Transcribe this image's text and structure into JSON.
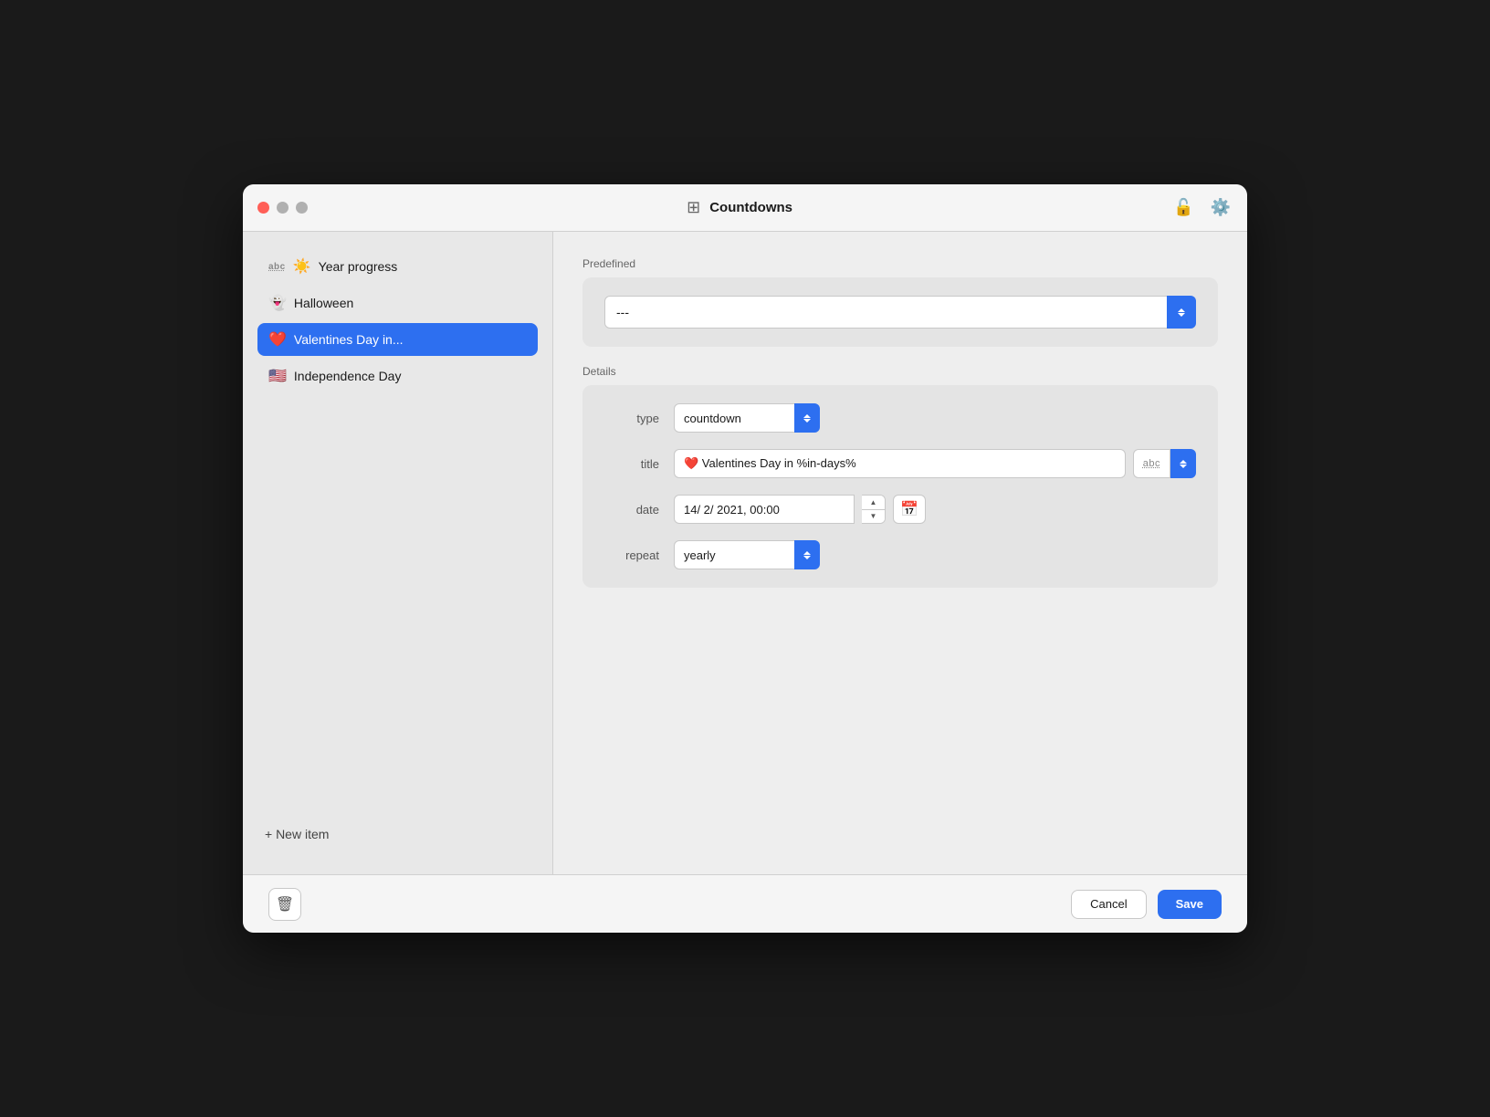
{
  "window": {
    "title": "Countdowns"
  },
  "sidebar": {
    "items": [
      {
        "id": "year-progress",
        "abc": "abc",
        "emoji": "☀️",
        "label": "Year progress",
        "active": false
      },
      {
        "id": "halloween",
        "emoji": "👻",
        "label": "Halloween",
        "active": false
      },
      {
        "id": "valentines",
        "emoji": "❤️",
        "label": "Valentines Day in...",
        "active": true
      },
      {
        "id": "independence",
        "emoji": "🇺🇸",
        "label": "Independence Day",
        "active": false
      }
    ],
    "new_item_label": "+ New item"
  },
  "predefined": {
    "label": "Predefined",
    "value": "---"
  },
  "details": {
    "label": "Details",
    "type_label": "type",
    "type_value": "countdown",
    "title_label": "title",
    "title_value": "❤️ Valentines Day in %in-days%",
    "date_label": "date",
    "date_value": "14/ 2/ 2021, 00:00",
    "repeat_label": "repeat",
    "repeat_value": "yearly"
  },
  "buttons": {
    "cancel": "Cancel",
    "save": "Save"
  },
  "icons": {
    "sidebar_toggle": "⊞",
    "lock": "🔓",
    "gear": "⚙️",
    "delete": "🗑",
    "calendar": "📅"
  }
}
